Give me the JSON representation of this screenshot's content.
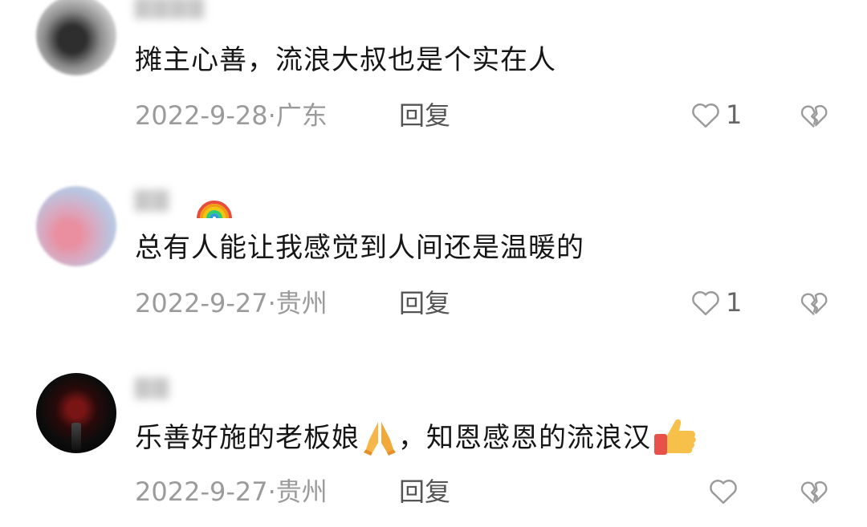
{
  "comments": [
    {
      "username": "▇▇▇▇",
      "text": "摊主心善，流浪大叔也是个实在人",
      "date": "2022-9-28",
      "location": "广东",
      "reply_label": "回复",
      "like_count": "1"
    },
    {
      "username": "▇▇",
      "text": "总有人能让我感觉到人间还是温暖的",
      "date": "2022-9-27",
      "location": "贵州",
      "reply_label": "回复",
      "like_count": "1"
    },
    {
      "username": "▇▇",
      "text_part1": "乐善好施的老板娘",
      "text_part2": "，知恩感恩的流浪汉",
      "date": "2022-9-27",
      "location": "贵州",
      "reply_label": "回复",
      "like_count": ""
    }
  ],
  "icons": {
    "like": "heart-outline-icon",
    "dislike": "broken-heart-icon",
    "emoji_rainbow": "rainbow-icon",
    "emoji_pray": "folded-hands-icon",
    "emoji_thumb": "thumbs-up-icon"
  },
  "colors": {
    "text": "#161616",
    "meta": "#9b9b9b",
    "reply": "#555555",
    "icon": "#9a9a9a"
  }
}
